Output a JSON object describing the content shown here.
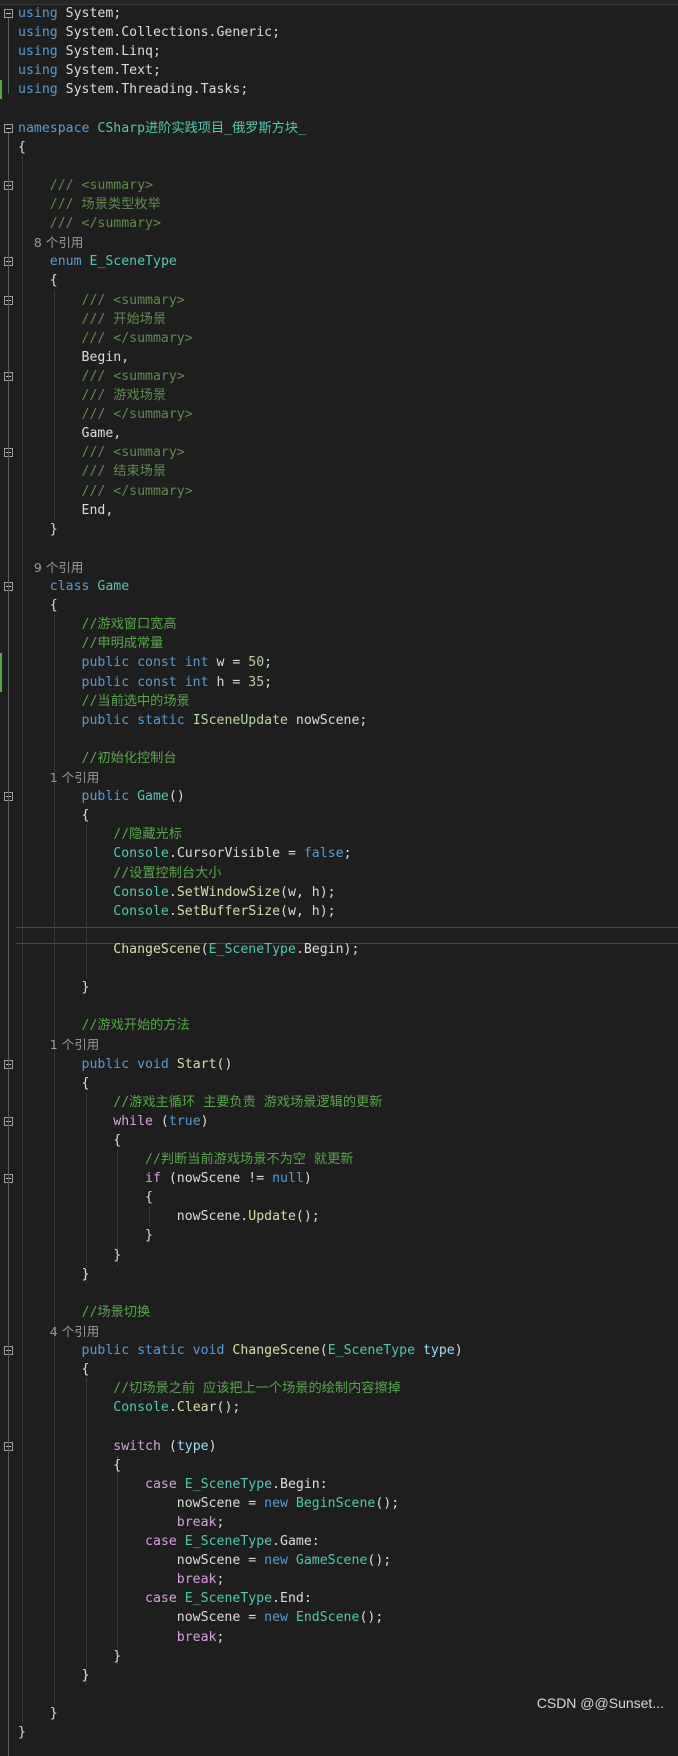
{
  "editor": {
    "lines": [
      [
        [
          "kw",
          "using"
        ],
        [
          "pl",
          " System;"
        ]
      ],
      [
        [
          "kw",
          "using"
        ],
        [
          "pl",
          " System.Collections.Generic;"
        ]
      ],
      [
        [
          "kw",
          "using"
        ],
        [
          "pl",
          " System.Linq;"
        ]
      ],
      [
        [
          "kw",
          "using"
        ],
        [
          "pl",
          " System.Text;"
        ]
      ],
      [
        [
          "kw",
          "using"
        ],
        [
          "pl",
          " System.Threading.Tasks;"
        ]
      ],
      [],
      [
        [
          "kw",
          "namespace"
        ],
        [
          "pl",
          " "
        ],
        [
          "ty",
          "CSharp进阶实践项目_俄罗斯方块_"
        ]
      ],
      [
        [
          "pl",
          "{"
        ]
      ],
      [],
      [
        [
          "xd",
          "    /// <summary>"
        ]
      ],
      [
        [
          "xd",
          "    /// 场景类型枚举"
        ]
      ],
      [
        [
          "xd",
          "    /// </summary>"
        ]
      ],
      [
        [
          "codelens",
          "    8 个引用"
        ]
      ],
      [
        [
          "kw",
          "    enum"
        ],
        [
          "pl",
          " "
        ],
        [
          "ty",
          "E_SceneType"
        ]
      ],
      [
        [
          "pl",
          "    {"
        ]
      ],
      [
        [
          "xd",
          "        /// <summary>"
        ]
      ],
      [
        [
          "xd",
          "        /// 开始场景"
        ]
      ],
      [
        [
          "xd",
          "        /// </summary>"
        ]
      ],
      [
        [
          "pl",
          "        Begin,"
        ]
      ],
      [
        [
          "xd",
          "        /// <summary>"
        ]
      ],
      [
        [
          "xd",
          "        /// 游戏场景"
        ]
      ],
      [
        [
          "xd",
          "        /// </summary>"
        ]
      ],
      [
        [
          "pl",
          "        Game,"
        ]
      ],
      [
        [
          "xd",
          "        /// <summary>"
        ]
      ],
      [
        [
          "xd",
          "        /// 结束场景"
        ]
      ],
      [
        [
          "xd",
          "        /// </summary>"
        ]
      ],
      [
        [
          "pl",
          "        End,"
        ]
      ],
      [
        [
          "pl",
          "    }"
        ]
      ],
      [],
      [
        [
          "codelens",
          "    9 个引用"
        ]
      ],
      [
        [
          "kw",
          "    class"
        ],
        [
          "pl",
          " "
        ],
        [
          "ty",
          "Game"
        ]
      ],
      [
        [
          "pl",
          "    {"
        ]
      ],
      [
        [
          "cm",
          "        //游戏窗口宽高"
        ]
      ],
      [
        [
          "cm",
          "        //申明成常量"
        ]
      ],
      [
        [
          "kw",
          "        public const int"
        ],
        [
          "pl",
          " w = "
        ],
        [
          "num",
          "50"
        ],
        [
          "pl",
          ";"
        ]
      ],
      [
        [
          "kw",
          "        public const int"
        ],
        [
          "pl",
          " h = "
        ],
        [
          "num",
          "35"
        ],
        [
          "pl",
          ";"
        ]
      ],
      [
        [
          "cm",
          "        //当前选中的场景"
        ]
      ],
      [
        [
          "kw",
          "        public static"
        ],
        [
          "pl",
          " "
        ],
        [
          "ifc",
          "ISceneUpdate"
        ],
        [
          "pl",
          " nowScene;"
        ]
      ],
      [],
      [
        [
          "cm",
          "        //初始化控制台"
        ]
      ],
      [
        [
          "codelens",
          "        1 个引用"
        ]
      ],
      [
        [
          "kw",
          "        public"
        ],
        [
          "pl",
          " "
        ],
        [
          "ty",
          "Game"
        ],
        [
          "pl",
          "()"
        ]
      ],
      [
        [
          "pl",
          "        {"
        ]
      ],
      [
        [
          "cm",
          "            //隐藏光标"
        ]
      ],
      [
        [
          "ty",
          "            Console"
        ],
        [
          "pl",
          "."
        ],
        [
          "pl",
          "CursorVisible"
        ],
        [
          "pl",
          " = "
        ],
        [
          "kw",
          "false"
        ],
        [
          "pl",
          ";"
        ]
      ],
      [
        [
          "cm",
          "            //设置控制台大小"
        ]
      ],
      [
        [
          "ty",
          "            Console"
        ],
        [
          "pl",
          "."
        ],
        [
          "mth",
          "SetWindowSize"
        ],
        [
          "pl",
          "(w, h);"
        ]
      ],
      [
        [
          "ty",
          "            Console"
        ],
        [
          "pl",
          "."
        ],
        [
          "mth",
          "SetBufferSize"
        ],
        [
          "pl",
          "(w, h);"
        ]
      ],
      [],
      [
        [
          "mth",
          "            ChangeScene"
        ],
        [
          "pl",
          "("
        ],
        [
          "ty",
          "E_SceneType"
        ],
        [
          "pl",
          ".Begin);"
        ]
      ],
      [],
      [
        [
          "pl",
          "        }"
        ]
      ],
      [],
      [
        [
          "cm",
          "        //游戏开始的方法"
        ]
      ],
      [
        [
          "codelens",
          "        1 个引用"
        ]
      ],
      [
        [
          "kw",
          "        public void"
        ],
        [
          "pl",
          " "
        ],
        [
          "mth",
          "Start"
        ],
        [
          "pl",
          "()"
        ]
      ],
      [
        [
          "pl",
          "        {"
        ]
      ],
      [
        [
          "cm",
          "            //游戏主循环 主要负责 游戏场景逻辑的更新"
        ]
      ],
      [
        [
          "ctl",
          "            while"
        ],
        [
          "pl",
          " ("
        ],
        [
          "kw",
          "true"
        ],
        [
          "pl",
          ")"
        ]
      ],
      [
        [
          "pl",
          "            {"
        ]
      ],
      [
        [
          "cm",
          "                //判断当前游戏场景不为空 就更新"
        ]
      ],
      [
        [
          "ctl",
          "                if"
        ],
        [
          "pl",
          " (nowScene != "
        ],
        [
          "kw",
          "null"
        ],
        [
          "pl",
          ")"
        ]
      ],
      [
        [
          "pl",
          "                {"
        ]
      ],
      [
        [
          "pl",
          "                    nowScene."
        ],
        [
          "mth",
          "Update"
        ],
        [
          "pl",
          "();"
        ]
      ],
      [
        [
          "pl",
          "                }"
        ]
      ],
      [
        [
          "pl",
          "            }"
        ]
      ],
      [
        [
          "pl",
          "        }"
        ]
      ],
      [],
      [
        [
          "cm",
          "        //场景切换"
        ]
      ],
      [
        [
          "codelens",
          "        4 个引用"
        ]
      ],
      [
        [
          "kw",
          "        public static void"
        ],
        [
          "pl",
          " "
        ],
        [
          "mth",
          "ChangeScene"
        ],
        [
          "pl",
          "("
        ],
        [
          "ty",
          "E_SceneType"
        ],
        [
          "pl",
          " "
        ],
        [
          "par",
          "type"
        ],
        [
          "pl",
          ")"
        ]
      ],
      [
        [
          "pl",
          "        {"
        ]
      ],
      [
        [
          "cm",
          "            //切场景之前 应该把上一个场景的绘制内容擦掉"
        ]
      ],
      [
        [
          "ty",
          "            Console"
        ],
        [
          "pl",
          "."
        ],
        [
          "mth",
          "Clear"
        ],
        [
          "pl",
          "();"
        ]
      ],
      [],
      [
        [
          "ctl",
          "            switch"
        ],
        [
          "pl",
          " ("
        ],
        [
          "par",
          "type"
        ],
        [
          "pl",
          ")"
        ]
      ],
      [
        [
          "pl",
          "            {"
        ]
      ],
      [
        [
          "ctl",
          "                case"
        ],
        [
          "pl",
          " "
        ],
        [
          "ty",
          "E_SceneType"
        ],
        [
          "pl",
          ".Begin:"
        ]
      ],
      [
        [
          "pl",
          "                    nowScene = "
        ],
        [
          "kw",
          "new"
        ],
        [
          "pl",
          " "
        ],
        [
          "ty",
          "BeginScene"
        ],
        [
          "pl",
          "();"
        ]
      ],
      [
        [
          "ctl",
          "                    break"
        ],
        [
          "pl",
          ";"
        ]
      ],
      [
        [
          "ctl",
          "                case"
        ],
        [
          "pl",
          " "
        ],
        [
          "ty",
          "E_SceneType"
        ],
        [
          "pl",
          ".Game:"
        ]
      ],
      [
        [
          "pl",
          "                    nowScene = "
        ],
        [
          "kw",
          "new"
        ],
        [
          "pl",
          " "
        ],
        [
          "ty",
          "GameScene"
        ],
        [
          "pl",
          "();"
        ]
      ],
      [
        [
          "ctl",
          "                    break"
        ],
        [
          "pl",
          ";"
        ]
      ],
      [
        [
          "ctl",
          "                case"
        ],
        [
          "pl",
          " "
        ],
        [
          "ty",
          "E_SceneType"
        ],
        [
          "pl",
          ".End:"
        ]
      ],
      [
        [
          "pl",
          "                    nowScene = "
        ],
        [
          "kw",
          "new"
        ],
        [
          "pl",
          " "
        ],
        [
          "ty",
          "EndScene"
        ],
        [
          "pl",
          "();"
        ]
      ],
      [
        [
          "ctl",
          "                    break"
        ],
        [
          "pl",
          ";"
        ]
      ],
      [
        [
          "pl",
          "            }"
        ]
      ],
      [
        [
          "pl",
          "        }"
        ]
      ],
      [],
      [
        [
          "pl",
          "    }"
        ]
      ],
      [
        [
          "pl",
          "}"
        ]
      ]
    ]
  },
  "watermark": "CSDN @@Sunset..."
}
